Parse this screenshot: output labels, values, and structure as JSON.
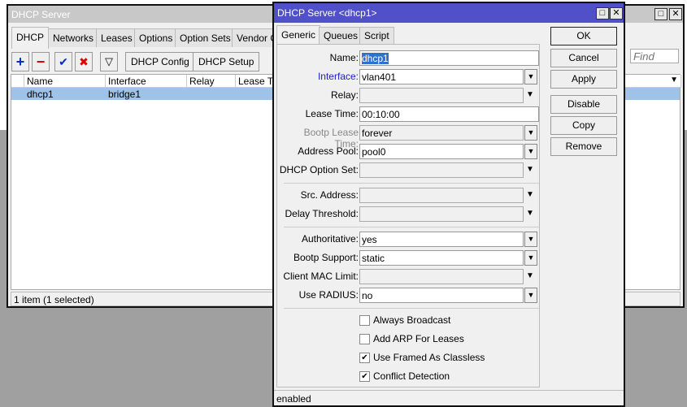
{
  "bg_window": {
    "title": "DHCP Server",
    "tabs": [
      "DHCP",
      "Networks",
      "Leases",
      "Options",
      "Option Sets",
      "Vendor C"
    ],
    "toolbar": {
      "dhcp_config": "DHCP Config",
      "dhcp_setup": "DHCP Setup",
      "find_placeholder": "Find"
    },
    "columns": [
      "Name",
      "Interface",
      "Relay",
      "Lease Tir"
    ],
    "rows": [
      {
        "name": "dhcp1",
        "interface": "bridge1",
        "relay": "",
        "lease_time": ""
      }
    ],
    "status": "1 item (1 selected)"
  },
  "dialog": {
    "title": "DHCP Server <dhcp1>",
    "tabs": [
      "Generic",
      "Queues",
      "Script"
    ],
    "fields": {
      "name": {
        "label": "Name:",
        "value": "dhcp1"
      },
      "interface": {
        "label": "Interface:",
        "value": "vlan401"
      },
      "relay": {
        "label": "Relay:",
        "value": ""
      },
      "lease_time": {
        "label": "Lease Time:",
        "value": "00:10:00"
      },
      "bootp_lease_time": {
        "label": "Bootp Lease Time:",
        "value": "forever"
      },
      "address_pool": {
        "label": "Address Pool:",
        "value": "pool0"
      },
      "dhcp_option_set": {
        "label": "DHCP Option Set:",
        "value": ""
      },
      "src_address": {
        "label": "Src. Address:",
        "value": ""
      },
      "delay_threshold": {
        "label": "Delay Threshold:",
        "value": ""
      },
      "authoritative": {
        "label": "Authoritative:",
        "value": "yes"
      },
      "bootp_support": {
        "label": "Bootp Support:",
        "value": "static"
      },
      "client_mac_limit": {
        "label": "Client MAC Limit:",
        "value": ""
      },
      "use_radius": {
        "label": "Use RADIUS:",
        "value": "no"
      }
    },
    "checkboxes": [
      {
        "label": "Always Broadcast",
        "checked": false
      },
      {
        "label": "Add ARP For Leases",
        "checked": false
      },
      {
        "label": "Use Framed As Classless",
        "checked": true
      },
      {
        "label": "Conflict Detection",
        "checked": true
      }
    ],
    "buttons": {
      "ok": "OK",
      "cancel": "Cancel",
      "apply": "Apply",
      "disable": "Disable",
      "copy": "Copy",
      "remove": "Remove"
    },
    "status": "enabled"
  }
}
